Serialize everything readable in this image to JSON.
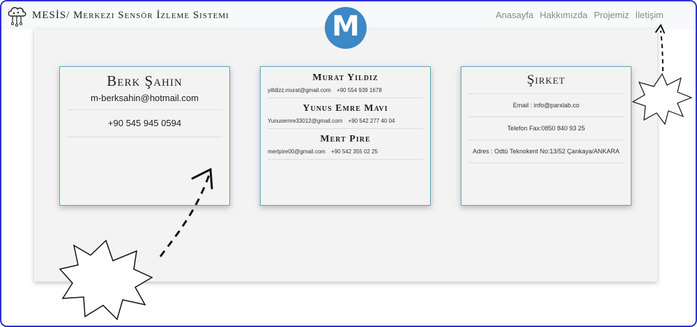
{
  "navbar": {
    "brand_text": "MESİS/ Merkezi Sensör İzleme Sistemi",
    "links": [
      "Anasayfa",
      "Hakkımızda",
      "Projemiz",
      "İletişim"
    ],
    "logo_letter": "M"
  },
  "card1": {
    "name": "Berk Şahin",
    "email": "m-berksahin@hotmail.com",
    "phone": "+90 545 945 0594"
  },
  "card2": {
    "members": [
      {
        "name": "Murat Yıldız",
        "email": "yilldizz.murat@gmail.com",
        "phone": "+90 554 939 1678"
      },
      {
        "name": "Yunus Emre Mavi",
        "email": "Yunusemre33012@gmail.com",
        "phone": "+90 542 277 40 04"
      },
      {
        "name": "Mert Pire",
        "email": "mertpire00@gmail.com",
        "phone": "+90 542 355 02 25"
      }
    ]
  },
  "card3": {
    "title": "Şirket",
    "email": "Email : info@parxlab.co",
    "fax": "Telefon Fax:0850 840 93 25",
    "address": "Adres : Odtü Teknokent No:13/52 Çankaya/ANKARA"
  },
  "colors": {
    "border": "#2b2fd6",
    "logo": "#3d88c6",
    "card_border": "#5aa9b3"
  }
}
